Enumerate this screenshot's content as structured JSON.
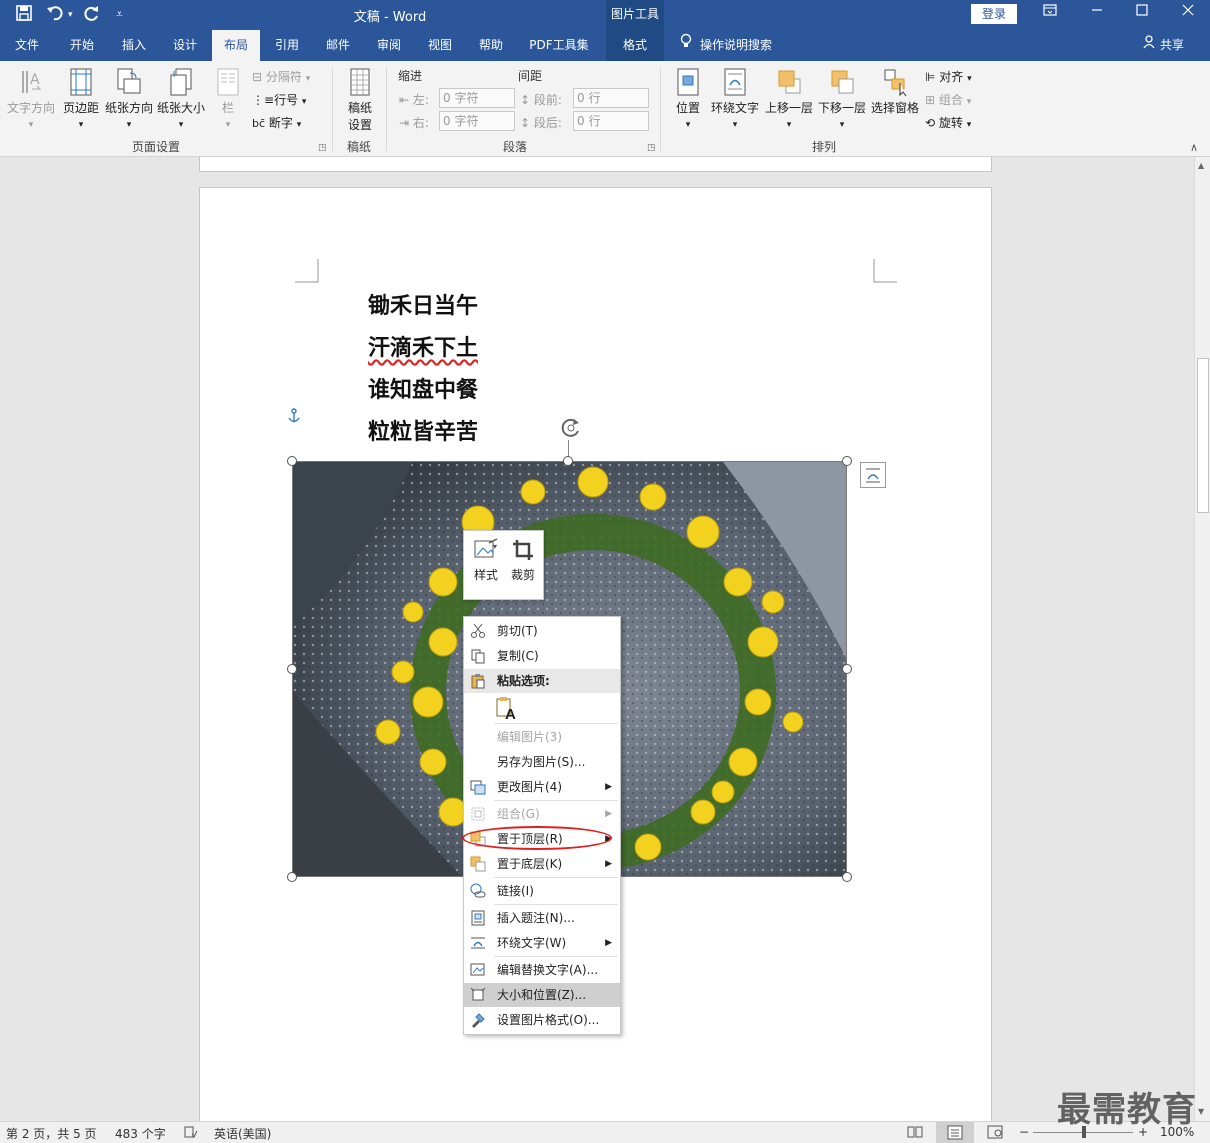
{
  "titlebar": {
    "doc_title": "文稿",
    "app_sep": " - ",
    "app_name": "Word",
    "context_group": "图片工具",
    "login": "登录"
  },
  "tabs": [
    {
      "label": "文件"
    },
    {
      "label": "开始"
    },
    {
      "label": "插入"
    },
    {
      "label": "设计"
    },
    {
      "label": "布局"
    },
    {
      "label": "引用"
    },
    {
      "label": "邮件"
    },
    {
      "label": "审阅"
    },
    {
      "label": "视图"
    },
    {
      "label": "帮助"
    },
    {
      "label": "PDF工具集"
    },
    {
      "label": "格式"
    }
  ],
  "tellme": "操作说明搜索",
  "share": "共享",
  "ribbon": {
    "page_setup": {
      "text_direction": "文字方向",
      "margins": "页边距",
      "orientation": "纸张方向",
      "size": "纸张大小",
      "columns": "栏",
      "breaks": "分隔符",
      "line_numbers": "行号",
      "hyphenation": "断字",
      "label": "页面设置"
    },
    "manuscript": {
      "button_line1": "稿纸",
      "button_line2": "设置",
      "label": "稿纸"
    },
    "paragraph": {
      "indent_header": "缩进",
      "spacing_header": "间距",
      "left_label": "左:",
      "right_label": "右:",
      "before_label": "段前:",
      "after_label": "段后:",
      "left_value": "0 字符",
      "right_value": "0 字符",
      "before_value": "0 行",
      "after_value": "0 行",
      "label": "段落"
    },
    "arrange": {
      "position": "位置",
      "wrap_text": "环绕文字",
      "bring_forward": "上移一层",
      "send_backward": "下移一层",
      "selection_pane": "选择窗格",
      "align": "对齐",
      "group": "组合",
      "rotate": "旋转",
      "label": "排列"
    }
  },
  "document": {
    "poem": [
      "锄禾日当午",
      "汗滴禾下土",
      "谁知盘中餐",
      "粒粒皆辛苦"
    ]
  },
  "minibar": {
    "style": "样式",
    "crop": "裁剪"
  },
  "context_menu": {
    "cut": "剪切(T)",
    "copy": "复制(C)",
    "paste_options": "粘贴选项:",
    "edit_picture": "编辑图片(3)",
    "save_as_picture": "另存为图片(S)...",
    "change_picture": "更改图片(4)",
    "group": "组合(G)",
    "bring_to_front": "置于顶层(R)",
    "send_to_back": "置于底层(K)",
    "link": "链接(I)",
    "insert_caption": "插入题注(N)...",
    "wrap_text": "环绕文字(W)",
    "edit_alt_text": "编辑替换文字(A)...",
    "size_and_position": "大小和位置(Z)...",
    "format_picture": "设置图片格式(O)..."
  },
  "statusbar": {
    "page": "第 2 页，共 5 页",
    "words": "483 个字",
    "language": "英语(美国)",
    "zoom": "100%"
  },
  "watermark": "最需教育",
  "colors": {
    "accent": "#2b579a",
    "highlight_circle": "#e02020"
  }
}
